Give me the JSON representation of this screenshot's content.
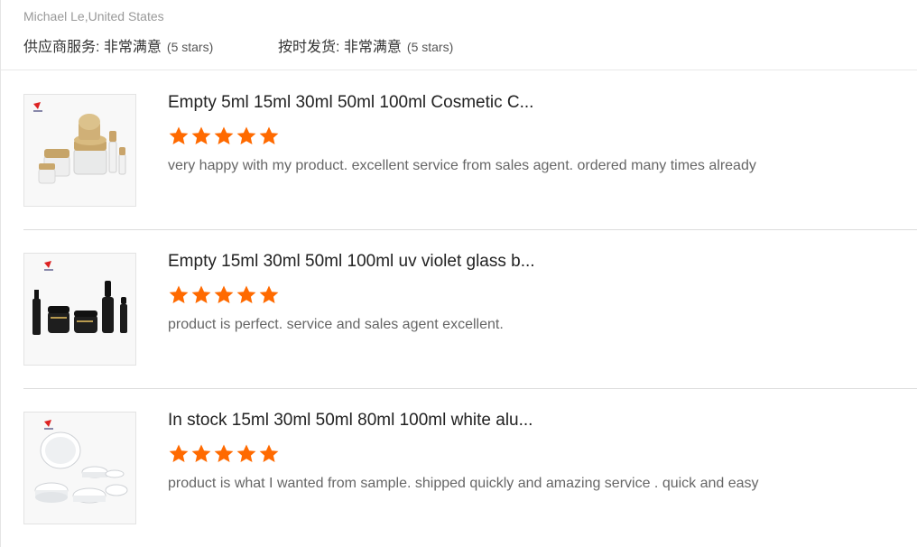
{
  "reviewer": {
    "name_location": "Michael Le,United States"
  },
  "ratings": {
    "supplier_service": {
      "label": "供应商服务: 非常满意",
      "note": "(5 stars)",
      "stars": 5
    },
    "delivery": {
      "label": "按时发货: 非常满意",
      "note": "(5 stars)",
      "stars": 5
    }
  },
  "star_color": "#ff6a00",
  "products": [
    {
      "title": "Empty 5ml 15ml 30ml 50ml 100ml Cosmetic C...",
      "stars": 5,
      "review": "very happy with my product.  excellent service from sales agent.  ordered many times already",
      "thumbnail_icon": "bamboo-lid-glass-jars-image"
    },
    {
      "title": "Empty 15ml 30ml 50ml 100ml uv violet glass b...",
      "stars": 5,
      "review": "product is perfect.  service and sales agent excellent.",
      "thumbnail_icon": "black-glass-bottles-image"
    },
    {
      "title": "In stock 15ml 30ml 50ml 80ml 100ml white alu...",
      "stars": 5,
      "review": "product is what I wanted from sample.  shipped quickly and amazing service .  quick and easy",
      "thumbnail_icon": "white-aluminum-tins-image"
    }
  ]
}
